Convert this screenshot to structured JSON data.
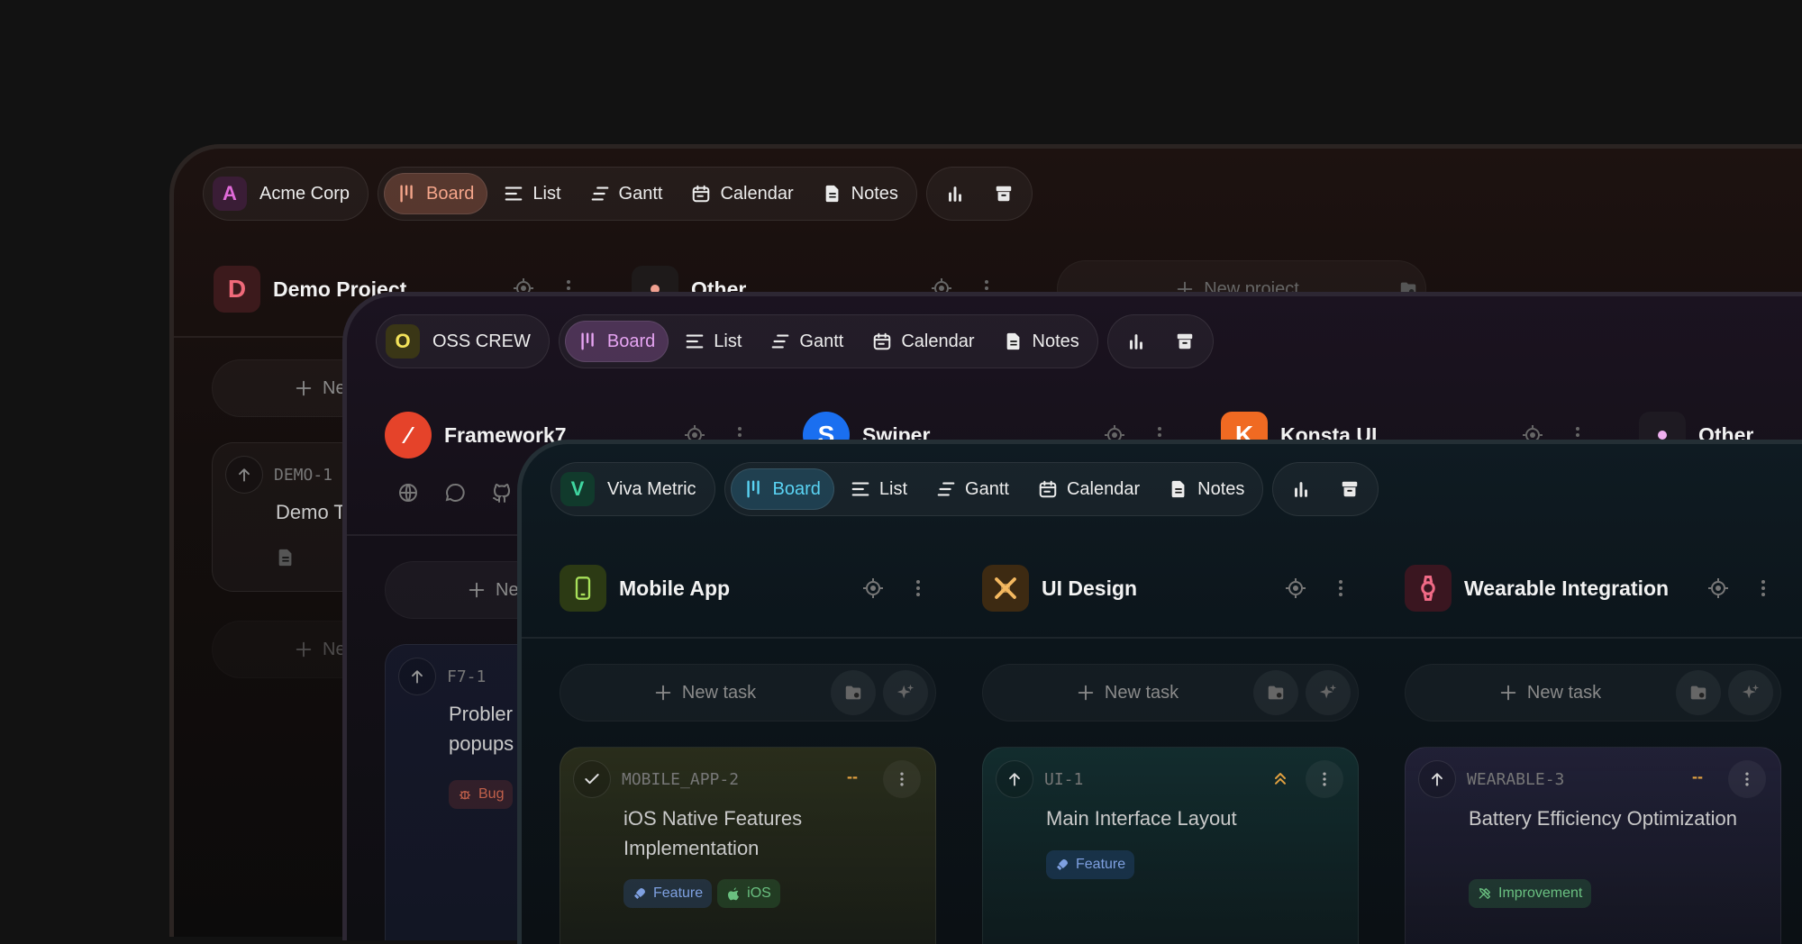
{
  "tabs": {
    "board": "Board",
    "list": "List",
    "gantt": "Gantt",
    "calendar": "Calendar",
    "notes": "Notes"
  },
  "window1": {
    "workspace": {
      "initial": "A",
      "name": "Acme Corp"
    },
    "projects": [
      {
        "initial": "D",
        "name": "Demo Project"
      },
      {
        "name": "Other"
      },
      {
        "label": "New project"
      }
    ],
    "new_task_partial": "Ne",
    "card": {
      "code": "DEMO-1",
      "title_partial": "Demo T"
    },
    "new_partial": "Ne"
  },
  "window2": {
    "workspace": {
      "initial": "O",
      "name": "OSS CREW"
    },
    "projects": [
      {
        "name": "Framework7"
      },
      {
        "name": "Swiper"
      },
      {
        "name": "Konsta UI"
      },
      {
        "name": "Other"
      }
    ],
    "new_task_partial": "Ne",
    "card": {
      "code": "F7-1",
      "title_line1": "Probler",
      "title_line2": "popups",
      "tag": "Bug"
    }
  },
  "window3": {
    "workspace": {
      "initial": "V",
      "name": "Viva Metric"
    },
    "projects": [
      {
        "name": "Mobile App",
        "icon": "phone-icon"
      },
      {
        "name": "UI Design",
        "icon": "design-icon"
      },
      {
        "name": "Wearable Integration",
        "icon": "watch-icon"
      }
    ],
    "new_task_label": "New task",
    "cards": [
      {
        "code": "MOBILE_APP-2",
        "title": "iOS Native Features Implementation",
        "priority": "--",
        "status": "done",
        "tags": [
          "Feature",
          "iOS"
        ]
      },
      {
        "code": "UI-1",
        "title": "Main Interface Layout",
        "priority": "high",
        "status": "up",
        "tags": [
          "Feature"
        ]
      },
      {
        "code": "WEARABLE-3",
        "title": "Battery Efficiency Optimization",
        "priority": "--",
        "status": "up",
        "tags": [
          "Improvement"
        ]
      }
    ]
  },
  "colors": {
    "acme": "#e06ad9",
    "oss": "#f4e35a",
    "viva": "#3fd6a0",
    "board_active_1": "#f4a58a",
    "board_active_2": "#e6a4f2",
    "board_active_3": "#5ad4f4"
  }
}
